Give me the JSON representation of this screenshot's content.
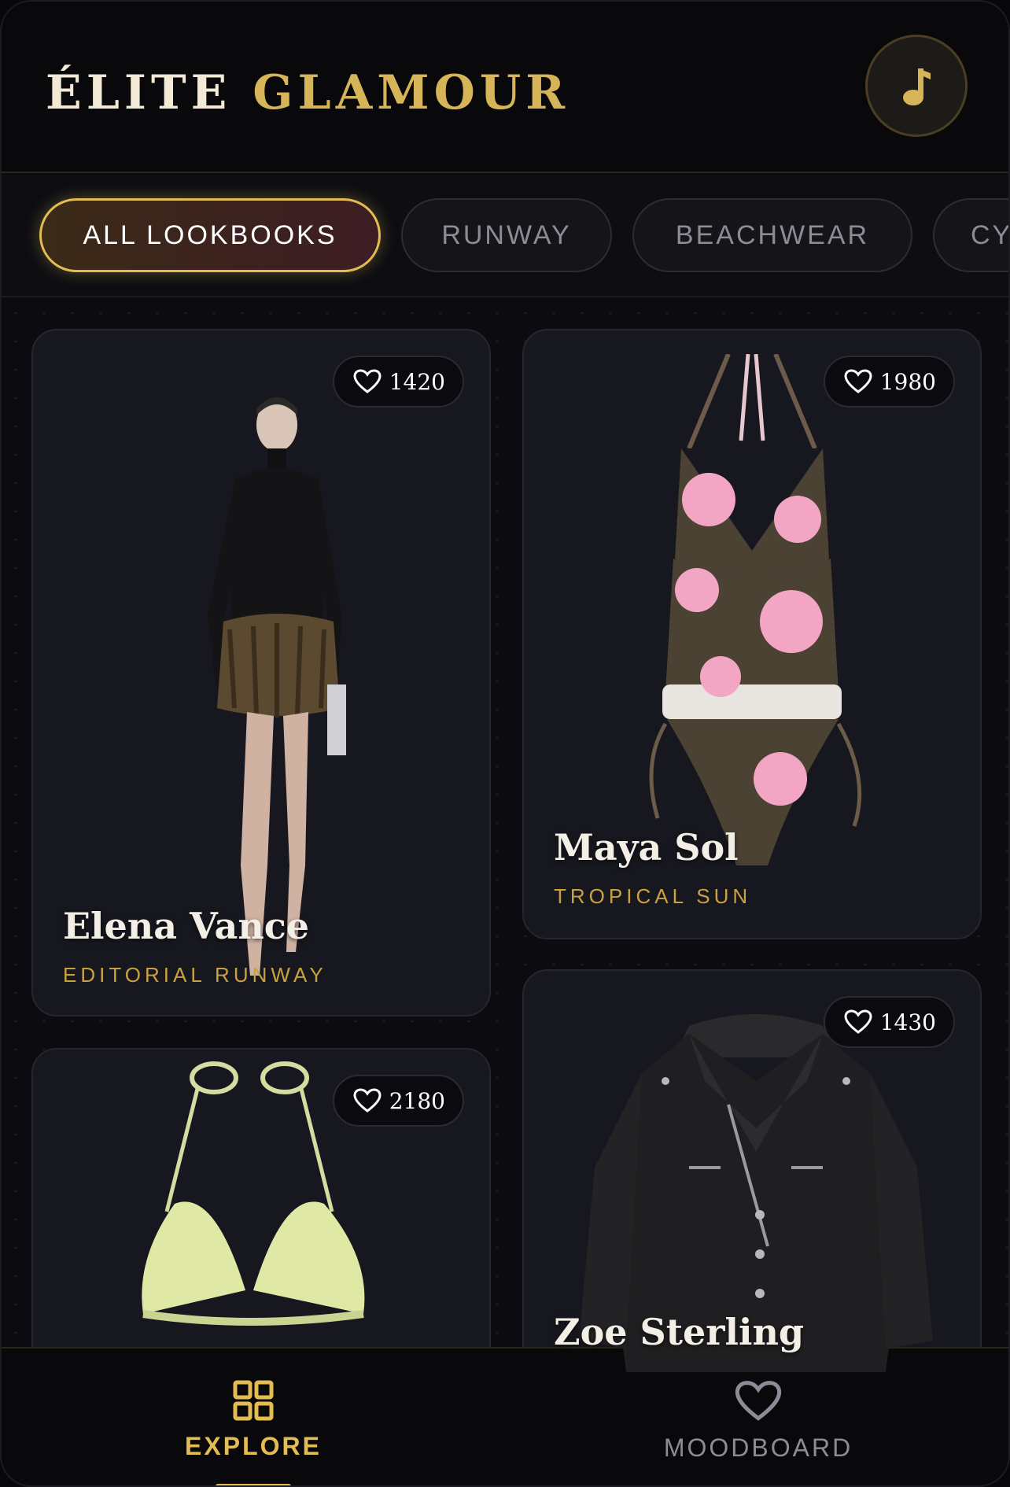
{
  "header": {
    "brand_part1": "ÉLITE",
    "brand_part2": "GLAMOUR",
    "music_icon": "music-note-icon"
  },
  "filters": [
    {
      "label": "ALL LOOKBOOKS",
      "active": true
    },
    {
      "label": "RUNWAY",
      "active": false
    },
    {
      "label": "BEACHWEAR",
      "active": false
    },
    {
      "label": "CY",
      "active": false
    }
  ],
  "cards": [
    {
      "name": "Elena Vance",
      "category": "EDITORIAL RUNWAY",
      "likes": "1420"
    },
    {
      "name": "Maya Sol",
      "category": "TROPICAL SUN",
      "likes": "1980"
    },
    {
      "name": "",
      "category": "",
      "likes": "2180"
    },
    {
      "name": "Zoe Sterling",
      "category": "",
      "likes": "1430"
    }
  ],
  "nav": {
    "explore_label": "EXPLORE",
    "moodboard_label": "MOODBOARD"
  },
  "colors": {
    "accent_gold": "#e3bd52",
    "background": "#0b0b10",
    "card": "#17171f"
  }
}
